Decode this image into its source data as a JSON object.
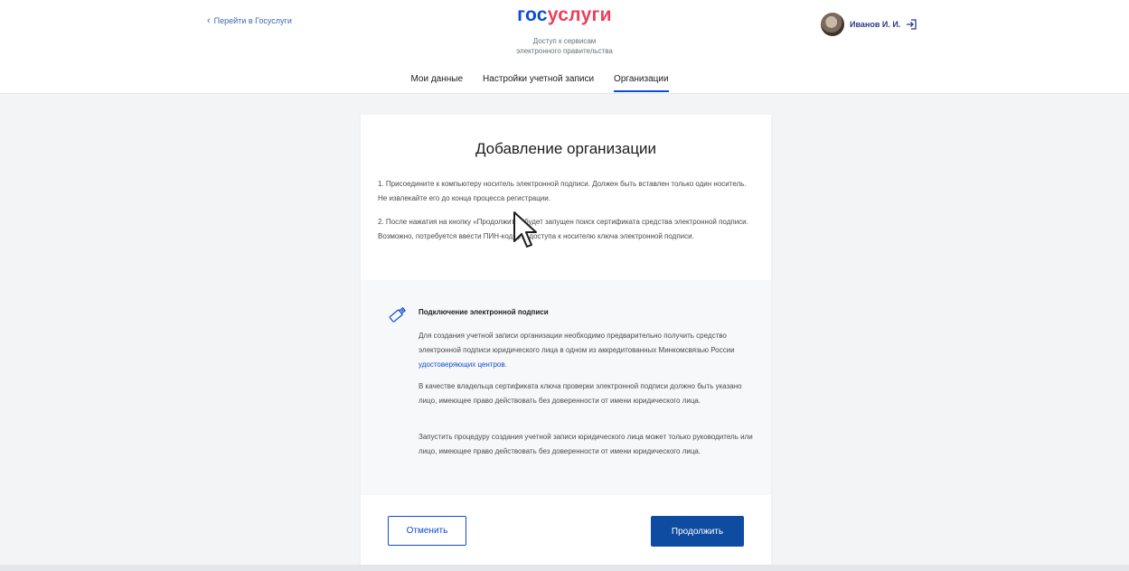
{
  "header": {
    "back_link": "Перейти в Госуслуги",
    "logo_gos": "гос",
    "logo_uslugi": "услуги",
    "subtitle_line1": "Доступ к сервисам",
    "subtitle_line2": "электронного правительства",
    "user_name": "Иванов И. И.",
    "user_icon": "avatar",
    "logout_icon": "logout-icon",
    "brand_blue": "#0d4cd3",
    "brand_red": "#ee3f58"
  },
  "tabs": [
    {
      "label": "Мои данные",
      "active": false
    },
    {
      "label": "Настройки учетной записи",
      "active": false
    },
    {
      "label": "Организации",
      "active": true
    }
  ],
  "card": {
    "title": "Добавление организации",
    "step1": "1. Присоедините к компьютеру носитель электронной подписи. Должен быть вставлен только один носитель. Не извлекайте его до конца процесса регистрации.",
    "step2": "2. После нажатия на кнопку «Продолжить» будет запущен поиск сертификата средства электронной подписи. Возможно, потребуется ввести ПИН-код для доступа к носителю ключа электронной подписи.",
    "info": {
      "icon": "usb-key-icon",
      "title": "Подключение электронной подписи",
      "para1_text": "Для создания учетной записи организации необходимо предварительно получить средство электронной подписи юридического лица в одном из аккредитованных Минкомсвязью России ",
      "para1_link": "удостоверяющих центров",
      "para1_end": ".",
      "para2": "В качестве владельца сертификата ключа проверки электронной подписи должно быть указано лицо, имеющее право действовать без доверенности от имени юридического лица.",
      "para3": "Запустить процедуру создания учетной записи юридического лица может только руководитель или лицо, имеющее право действовать без доверенности от имени юридического лица."
    },
    "cancel_label": "Отменить",
    "continue_label": "Продолжить",
    "continue_color": "#0d4ca0"
  }
}
